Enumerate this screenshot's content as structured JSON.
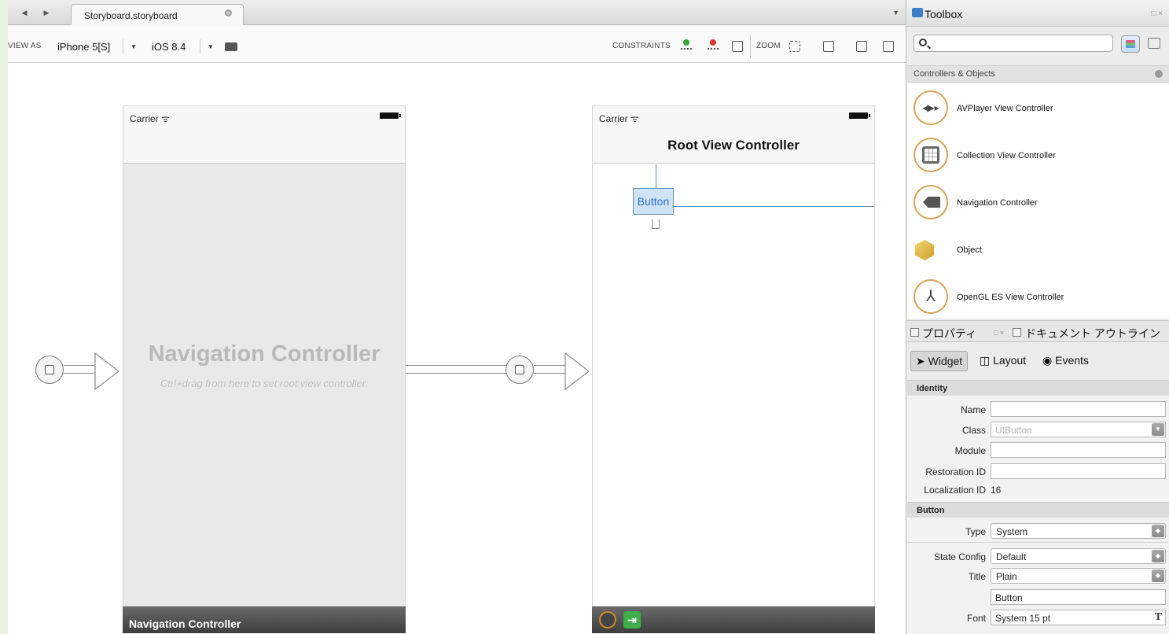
{
  "editor": {
    "tab_title": "Storyboard.storyboard",
    "toolbar": {
      "view_as_label": "VIEW AS",
      "device": "iPhone 5[S]",
      "os": "iOS 8.4",
      "constraints_label": "CONSTRAINTS",
      "zoom_label": "ZOOM"
    }
  },
  "canvas": {
    "nav_scene": {
      "carrier": "Carrier",
      "title": "Navigation Controller",
      "hint": "Ctrl+drag from here to set root view controller.",
      "footer": "Navigation Controller"
    },
    "root_scene": {
      "carrier": "Carrier",
      "nav_title": "Root View Controller",
      "button_label": "Button"
    }
  },
  "toolbox": {
    "title": "Toolbox",
    "search_placeholder": "",
    "section_title": "Controllers & Objects",
    "items": [
      {
        "label": "AVPlayer View Controller",
        "icon": "av-player-icon"
      },
      {
        "label": "Collection View Controller",
        "icon": "grid-icon"
      },
      {
        "label": "Navigation Controller",
        "icon": "navigation-icon"
      },
      {
        "label": "Object",
        "icon": "cube-icon"
      },
      {
        "label": "OpenGL ES View Controller",
        "icon": "opengl-icon"
      }
    ]
  },
  "properties": {
    "tab_properties": "プロパティ",
    "tab_outline": "ドキュメント アウトライン",
    "modes": {
      "widget": "Widget",
      "layout": "Layout",
      "events": "Events"
    },
    "identity": {
      "header": "Identity",
      "name_label": "Name",
      "name_value": "",
      "class_label": "Class",
      "class_placeholder": "UIButton",
      "module_label": "Module",
      "module_value": "",
      "restoration_label": "Restoration ID",
      "restoration_value": "",
      "localization_label": "Localization ID",
      "localization_value": "16"
    },
    "button": {
      "header": "Button",
      "type_label": "Type",
      "type_value": "System",
      "state_label": "State Config",
      "state_value": "Default",
      "title_label": "Title",
      "title_value": "Plain",
      "title_text": "Button",
      "font_label": "Font",
      "font_value": "System 15 pt"
    }
  }
}
